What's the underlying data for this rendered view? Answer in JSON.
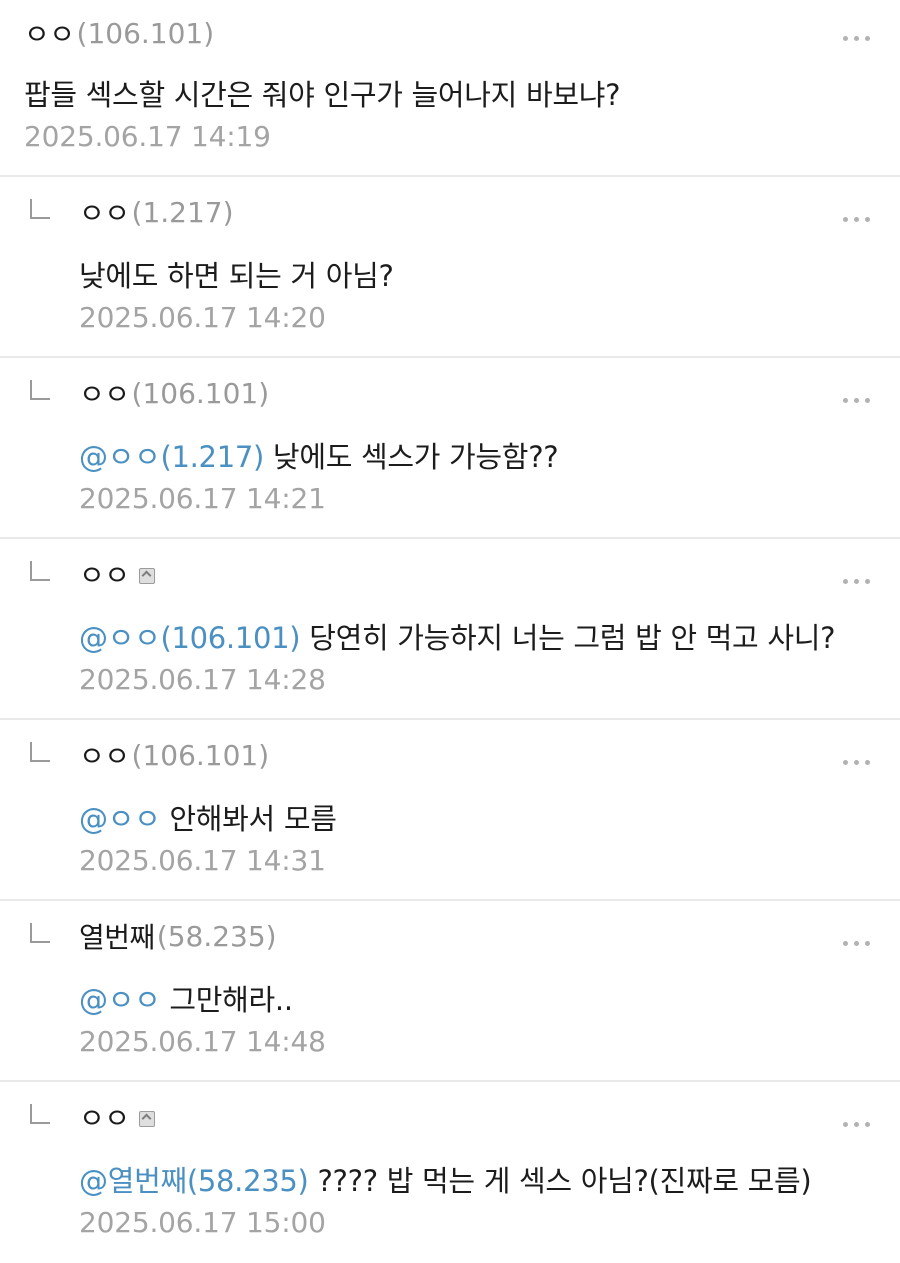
{
  "comments": [
    {
      "nick": "ㅇㅇ",
      "ip": "(106.101)",
      "mention": "",
      "text": "팝들 섹스할 시간은 줘야 인구가 늘어나지 바보냐?",
      "date": "2025.06.17 14:19"
    },
    {
      "nick": "ㅇㅇ",
      "ip": "(1.217)",
      "mention": "",
      "text": "낮에도 하면 되는 거 아님?",
      "date": "2025.06.17 14:20"
    },
    {
      "nick": "ㅇㅇ",
      "ip": "(106.101)",
      "mention": "@ㅇㅇ(1.217)",
      "text": " 낮에도 섹스가 가능함??",
      "date": "2025.06.17 14:21"
    },
    {
      "nick": "ㅇㅇ",
      "ip": "",
      "mention": "@ㅇㅇ(106.101)",
      "text": " 당연히 가능하지 너는 그럼 밥 안 먹고 사니?",
      "date": "2025.06.17 14:28"
    },
    {
      "nick": "ㅇㅇ",
      "ip": "(106.101)",
      "mention": "@ㅇㅇ",
      "text": " 안해봐서 모름",
      "date": "2025.06.17 14:31"
    },
    {
      "nick": "열번째",
      "ip": "(58.235)",
      "mention": "@ㅇㅇ",
      "text": " 그만해라..",
      "date": "2025.06.17 14:48"
    },
    {
      "nick": "ㅇㅇ",
      "ip": "",
      "mention": "@열번째(58.235)",
      "text": " ???? 밥 먹는 게 섹스 아님?(진짜로 모름)",
      "date": "2025.06.17 15:00"
    }
  ],
  "icons": {
    "more": "more-options-icon",
    "reply": "reply-arrow-icon",
    "badge": "fixed-nick-badge-icon"
  }
}
